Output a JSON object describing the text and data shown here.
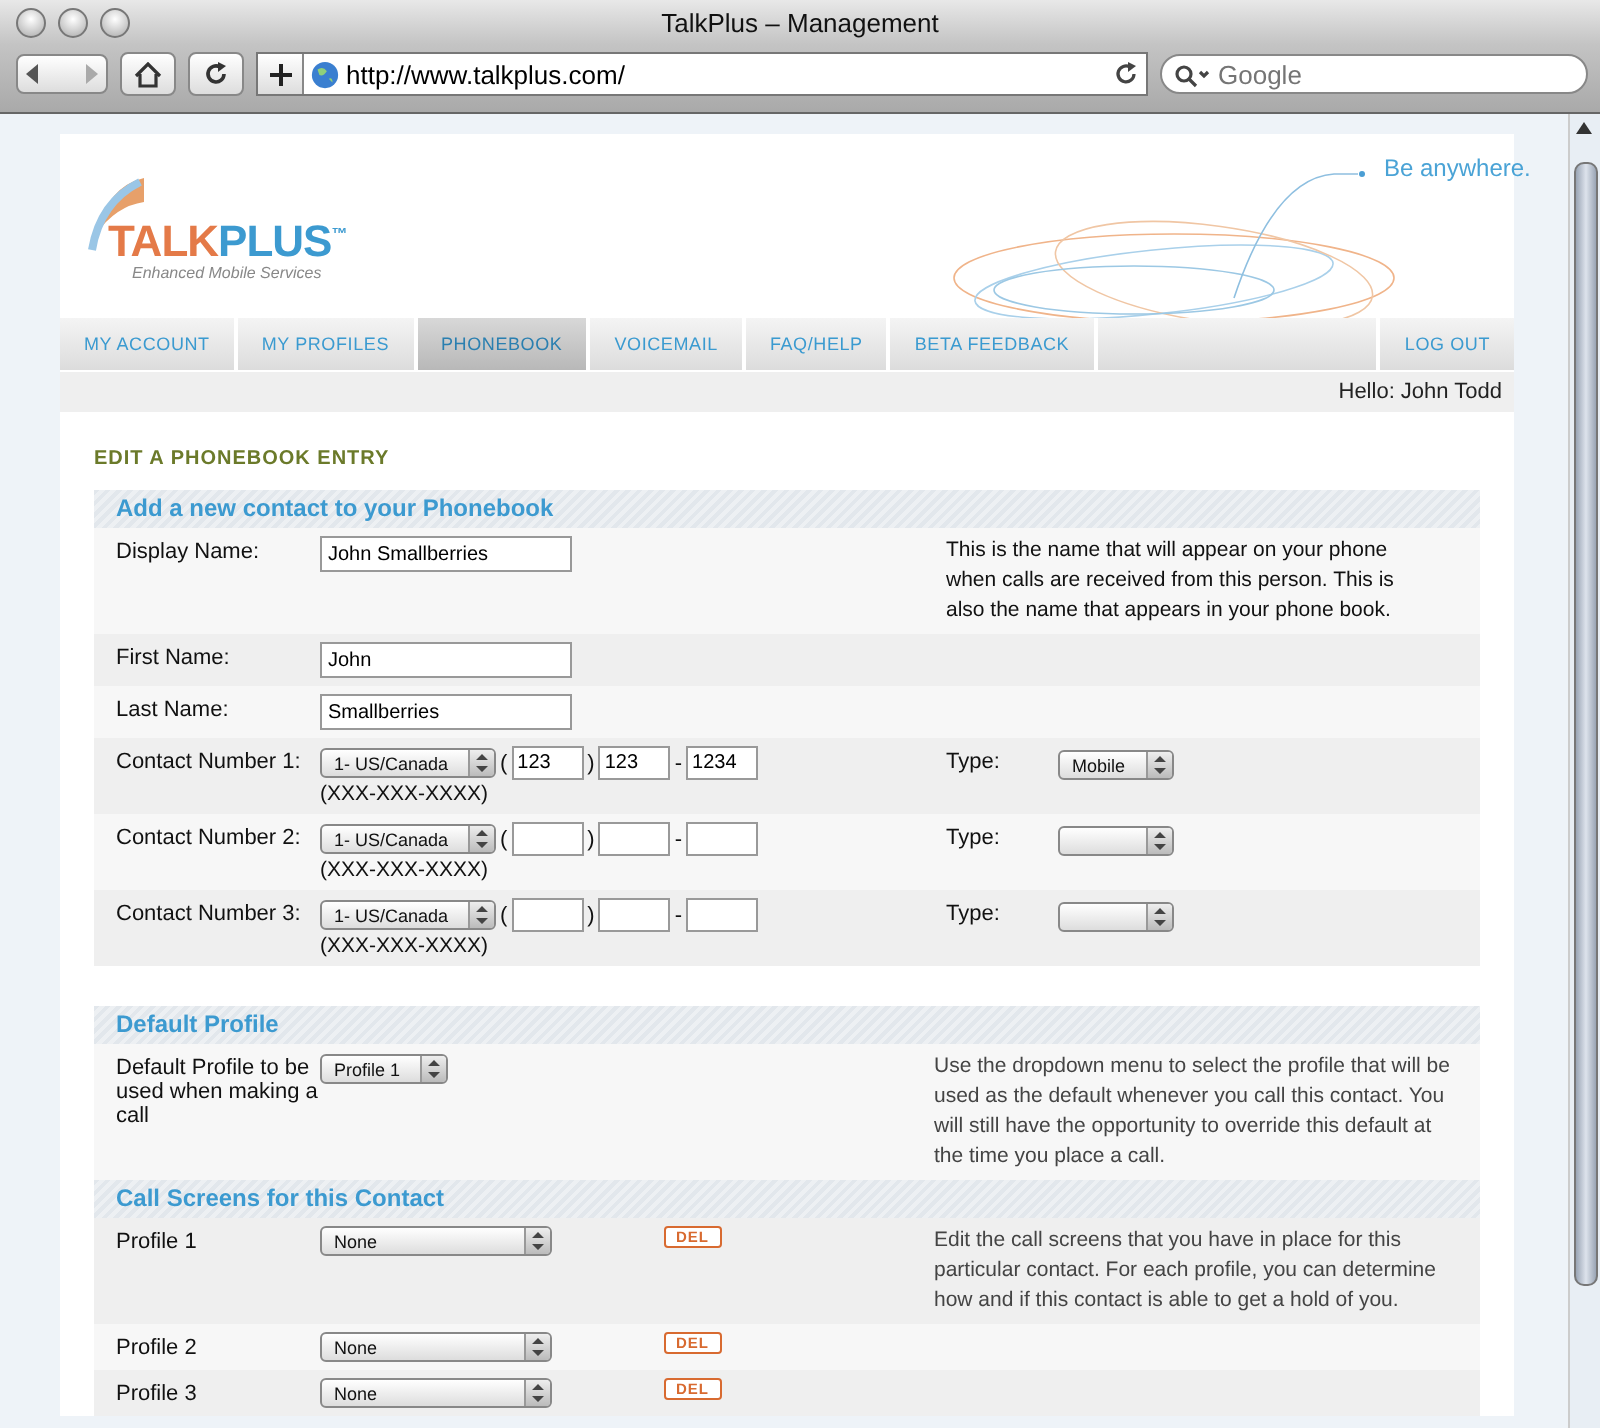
{
  "browser": {
    "title": "TalkPlus – Management",
    "url": "http://www.talkplus.com/",
    "search_placeholder": "Google"
  },
  "logo": {
    "wordmark": [
      "TALK",
      "PLUS"
    ],
    "trademark": "™",
    "tagline": "Enhanced Mobile Services"
  },
  "slogan": "Be anywhere.",
  "nav": [
    {
      "label": "MY ACCOUNT",
      "selected": false
    },
    {
      "label": "MY PROFILES",
      "selected": false
    },
    {
      "label": "PHONEBOOK",
      "selected": true
    },
    {
      "label": "VOICEMAIL",
      "selected": false
    },
    {
      "label": "FAQ/HELP",
      "selected": false
    },
    {
      "label": "BETA FEEDBACK",
      "selected": false
    }
  ],
  "logout": "LOG OUT",
  "greeting": "Hello: John Todd",
  "page_title": "EDIT A PHONEBOOK ENTRY",
  "contact": {
    "title": "Add a new contact to your Phonebook",
    "description": "This is the name that will appear on your phone when calls are received from this person. This is also the name that appears in your phone book.",
    "fields": [
      {
        "label": "Display Name:",
        "value": "John Smallberries"
      },
      {
        "label": "First Name:",
        "value": "John"
      },
      {
        "label": "Last Name:",
        "value": "Smallberries"
      }
    ],
    "numbers": [
      {
        "label": "Contact Number 1:",
        "country": "1- US/Canada",
        "open": "(",
        "close": ")",
        "dash": "-",
        "area": "123",
        "prefix": "123",
        "line": "1234",
        "format": "(XXX-XXX-XXXX)",
        "type_label": "Type:",
        "type": "Mobile"
      },
      {
        "label": "Contact Number 2:",
        "country": "1- US/Canada",
        "open": "(",
        "close": ")",
        "dash": "-",
        "format": "(XXX-XXX-XXXX)",
        "type_label": "Type:"
      },
      {
        "label": "Contact Number 3:",
        "country": "1- US/Canada",
        "open": "(",
        "close": ")",
        "dash": "-",
        "format": "(XXX-XXX-XXXX)",
        "type_label": "Type:"
      }
    ]
  },
  "default_profile": {
    "title": "Default Profile",
    "label": "Default Profile to be used when making a call",
    "value": "Profile 1",
    "description": "Use the dropdown menu to select the profile that will be used as the default whenever you call this contact. You will still have the opportunity to override this default at the time you place a call."
  },
  "call_screens": {
    "title": "Call Screens for this Contact",
    "description": "Edit the call screens that you have in place for this particular contact. For each profile, you can determine how and if this contact is able to get a hold of you.",
    "rows": [
      {
        "label": "Profile 1",
        "value": "None",
        "action": "DEL"
      },
      {
        "label": "Profile 2",
        "value": "None",
        "action": "DEL"
      },
      {
        "label": "Profile 3",
        "value": "None",
        "action": "DEL"
      }
    ]
  }
}
